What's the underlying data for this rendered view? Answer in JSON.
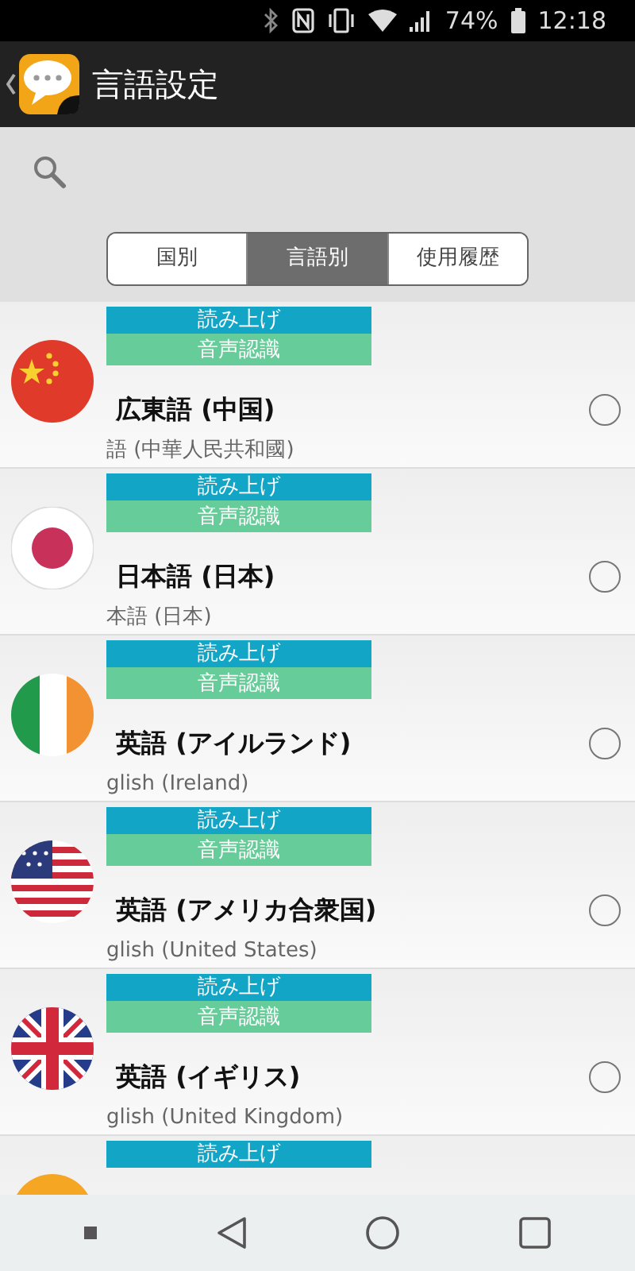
{
  "status_bar": {
    "battery": "74%",
    "time": "12:18"
  },
  "app_bar": {
    "title": "言語設定"
  },
  "tabs": [
    {
      "label": "国別",
      "selected": false
    },
    {
      "label": "言語別",
      "selected": true
    },
    {
      "label": "使用履歴",
      "selected": false
    }
  ],
  "languages": [
    {
      "badges": [
        {
          "text": "読み上げ",
          "kind": "tts"
        },
        {
          "text": "音声認識",
          "kind": "speech"
        }
      ],
      "name": "広東語 (中国)",
      "native": "語 (中華人民共和國)",
      "selected": false
    },
    {
      "badges": [
        {
          "text": "読み上げ",
          "kind": "tts"
        },
        {
          "text": "音声認識",
          "kind": "speech"
        }
      ],
      "name": "日本語 (日本)",
      "native": "本語 (日本)",
      "selected": false
    },
    {
      "badges": [
        {
          "text": "読み上げ",
          "kind": "tts"
        },
        {
          "text": "音声認識",
          "kind": "speech"
        }
      ],
      "name": "英語 (アイルランド)",
      "native": "glish (Ireland)",
      "selected": false
    },
    {
      "badges": [
        {
          "text": "読み上げ",
          "kind": "tts"
        },
        {
          "text": "音声認識",
          "kind": "speech"
        }
      ],
      "name": "英語 (アメリカ合衆国)",
      "native": "glish (United States)",
      "selected": false
    },
    {
      "badges": [
        {
          "text": "読み上げ",
          "kind": "tts"
        },
        {
          "text": "音声認識",
          "kind": "speech"
        }
      ],
      "name": "英語 (イギリス)",
      "native": "glish (United Kingdom)",
      "selected": false
    },
    {
      "badges": [
        {
          "text": "読み上げ",
          "kind": "tts"
        }
      ]
    }
  ]
}
